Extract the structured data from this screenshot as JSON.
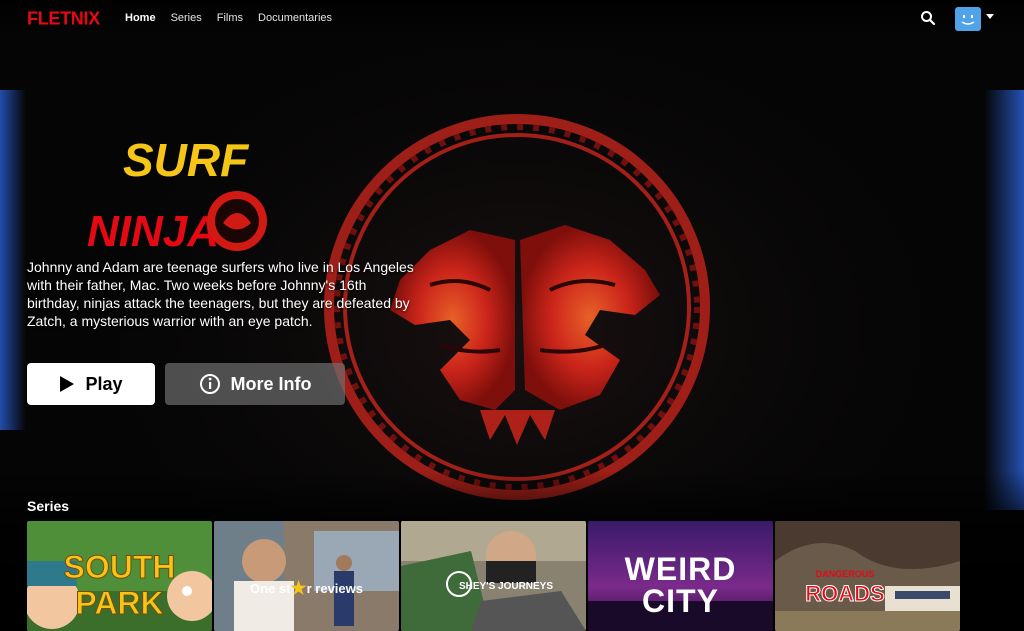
{
  "nav": {
    "logo": "FLETNIX",
    "links": [
      {
        "label": "Home",
        "active": true
      },
      {
        "label": "Series",
        "active": false
      },
      {
        "label": "Films",
        "active": false
      },
      {
        "label": "Documentaries",
        "active": false
      }
    ]
  },
  "hero": {
    "title_line1": "SURF",
    "title_line2": "NINJAS",
    "synopsis": "Johnny and Adam are teenage surfers who live in Los Angeles with their father, Mac. Two weeks before Johnny's 16th birthday, ninjas attack the teenagers, but they are defeated by Zatch, a mysterious warrior with an eye patch.",
    "play_label": "Play",
    "info_label": "More Info"
  },
  "row": {
    "title": "Series",
    "tiles": [
      {
        "line1": "SOUTH",
        "line2": "PARK"
      },
      {
        "line1": "One st",
        "line2": "r reviews"
      },
      {
        "line1": "SHEY'S JOURNEYS"
      },
      {
        "line1": "WEIRD",
        "line2": "CITY"
      },
      {
        "line1": "DANGEROUS",
        "line2": "ROADS"
      }
    ]
  },
  "colors": {
    "brand": "#e50914",
    "accent_emblem": "#e0281c",
    "title_yellow": "#f5c518"
  }
}
